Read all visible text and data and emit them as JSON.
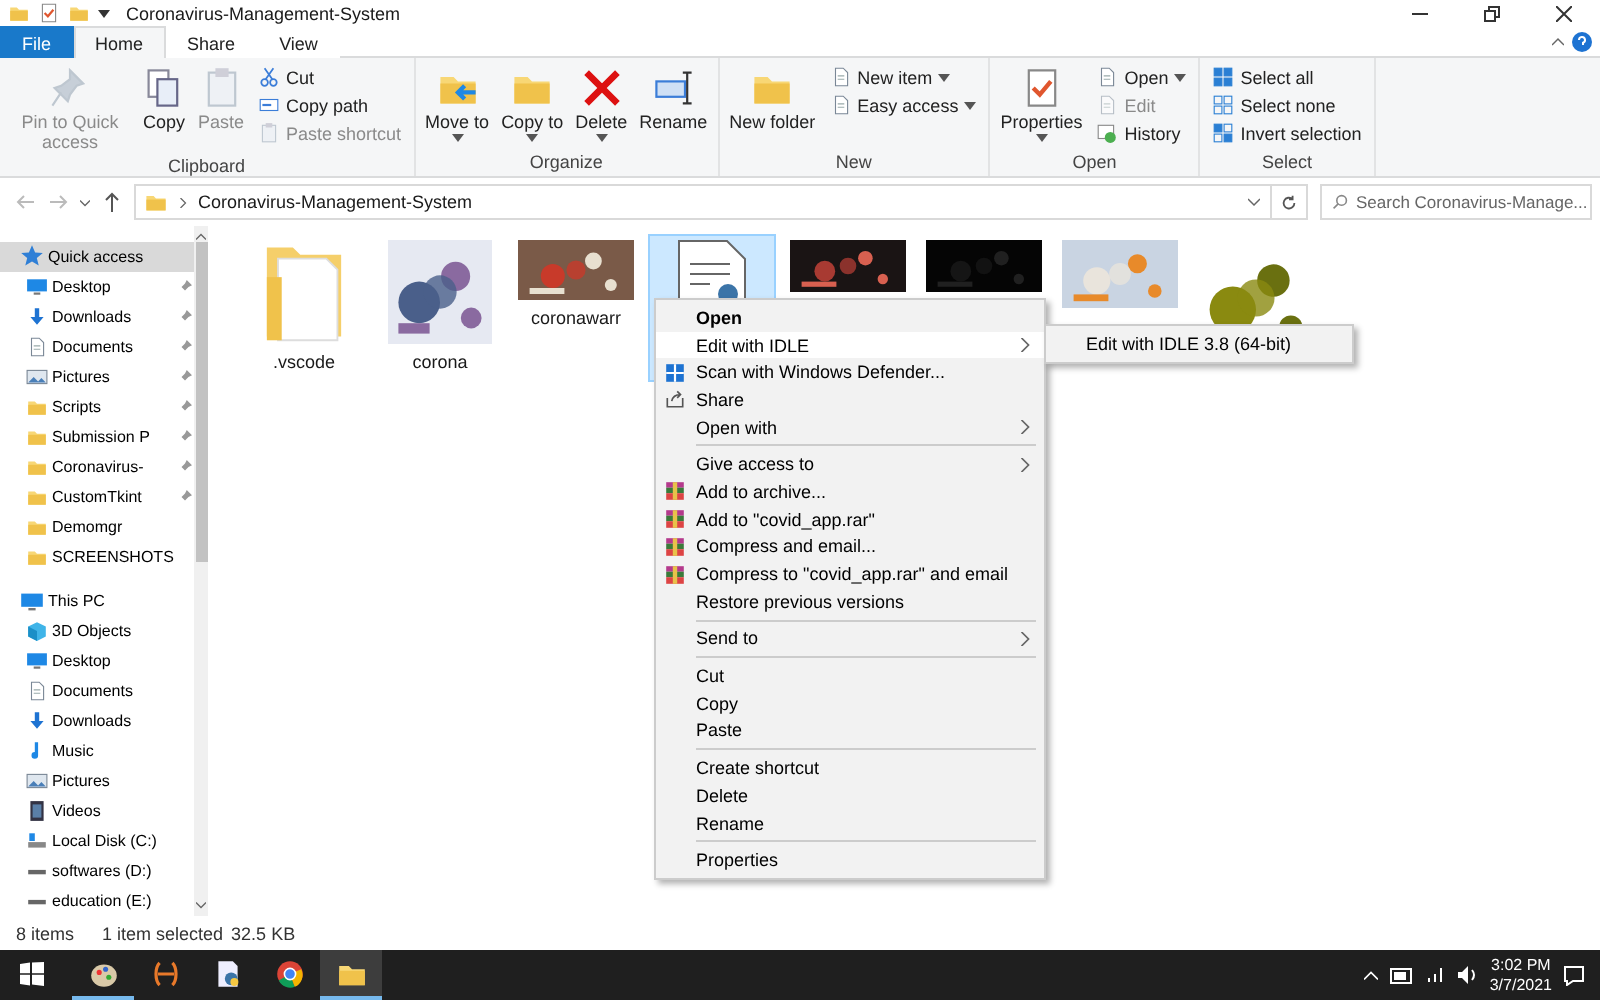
{
  "window": {
    "title": "Coronavirus-Management-System"
  },
  "tabs": [
    {
      "label": "File",
      "kind": "file",
      "selected": false
    },
    {
      "label": "Home",
      "kind": "tab",
      "selected": true
    },
    {
      "label": "Share",
      "kind": "tab",
      "selected": false
    },
    {
      "label": "View",
      "kind": "tab",
      "selected": false
    }
  ],
  "ribbon": [
    {
      "label": "Clipboard",
      "large": [
        {
          "label": "Pin to Quick access",
          "kind": "pin",
          "disabled": true,
          "dropdown": false
        },
        {
          "label": "Copy",
          "kind": "copy",
          "disabled": false,
          "dropdown": false
        },
        {
          "label": "Paste",
          "kind": "paste",
          "disabled": true,
          "dropdown": false
        }
      ],
      "small": [
        {
          "label": "Cut",
          "kind": "cut",
          "disabled": false,
          "dropdown": false
        },
        {
          "label": "Copy path",
          "kind": "copypath",
          "disabled": false,
          "dropdown": false
        },
        {
          "label": "Paste shortcut",
          "kind": "pasteshortcut",
          "disabled": true,
          "dropdown": false
        }
      ]
    },
    {
      "label": "Organize",
      "large": [
        {
          "label": "Move to",
          "kind": "move",
          "disabled": false,
          "dropdown": true
        },
        {
          "label": "Copy to",
          "kind": "copyto",
          "disabled": false,
          "dropdown": true
        },
        {
          "label": "Delete",
          "kind": "delete",
          "disabled": false,
          "dropdown": true
        },
        {
          "label": "Rename",
          "kind": "rename",
          "disabled": false,
          "dropdown": false
        }
      ]
    },
    {
      "label": "New",
      "large": [
        {
          "label": "New folder",
          "kind": "folder",
          "disabled": false,
          "dropdown": false
        }
      ],
      "small": [
        {
          "label": "New item",
          "kind": "newitem",
          "disabled": false,
          "dropdown": true
        },
        {
          "label": "Easy access",
          "kind": "easy",
          "disabled": false,
          "dropdown": true
        }
      ]
    },
    {
      "label": "Open",
      "large": [
        {
          "label": "Properties",
          "kind": "properties",
          "disabled": false,
          "dropdown": true
        }
      ],
      "small": [
        {
          "label": "Open",
          "kind": "open",
          "disabled": false,
          "dropdown": true
        },
        {
          "label": "Edit",
          "kind": "edit",
          "disabled": true,
          "dropdown": false
        },
        {
          "label": "History",
          "kind": "history",
          "disabled": false,
          "dropdown": false
        }
      ]
    },
    {
      "label": "Select",
      "small": [
        {
          "label": "Select all",
          "kind": "selectall",
          "disabled": false,
          "dropdown": false
        },
        {
          "label": "Select none",
          "kind": "selectnone",
          "disabled": false,
          "dropdown": false
        },
        {
          "label": "Invert selection",
          "kind": "invert",
          "disabled": false,
          "dropdown": false
        }
      ]
    }
  ],
  "address": {
    "path": "Coronavirus-Management-System",
    "search_placeholder": "Search Coronavirus-Manage..."
  },
  "sidebar": [
    {
      "label": "Quick access",
      "kind": "star",
      "pinned": false,
      "selected": true,
      "children": [
        {
          "label": "Desktop",
          "kind": "desktop",
          "pinned": true,
          "selected": false
        },
        {
          "label": "Downloads",
          "kind": "download",
          "pinned": true,
          "selected": false
        },
        {
          "label": "Documents",
          "kind": "documents",
          "pinned": true,
          "selected": false
        },
        {
          "label": "Pictures",
          "kind": "pictures",
          "pinned": true,
          "selected": false
        },
        {
          "label": "Scripts",
          "kind": "folder",
          "pinned": true,
          "selected": false
        },
        {
          "label": "Submission P",
          "kind": "folder",
          "pinned": true,
          "selected": false
        },
        {
          "label": "Coronavirus-",
          "kind": "folder",
          "pinned": true,
          "selected": false
        },
        {
          "label": "CustomTkint",
          "kind": "folder",
          "pinned": true,
          "selected": false
        },
        {
          "label": "Demomgr",
          "kind": "folder",
          "pinned": false,
          "selected": false
        },
        {
          "label": "SCREENSHOTS",
          "kind": "folder",
          "pinned": false,
          "selected": false
        }
      ]
    },
    {
      "label": "This PC",
      "kind": "pc",
      "pinned": false,
      "selected": false,
      "children": [
        {
          "label": "3D Objects",
          "kind": "cube",
          "pinned": false,
          "selected": false
        },
        {
          "label": "Desktop",
          "kind": "desktop",
          "pinned": false,
          "selected": false
        },
        {
          "label": "Documents",
          "kind": "documents",
          "pinned": false,
          "selected": false
        },
        {
          "label": "Downloads",
          "kind": "download",
          "pinned": false,
          "selected": false
        },
        {
          "label": "Music",
          "kind": "music",
          "pinned": false,
          "selected": false
        },
        {
          "label": "Pictures",
          "kind": "pictures",
          "pinned": false,
          "selected": false
        },
        {
          "label": "Videos",
          "kind": "videos",
          "pinned": false,
          "selected": false
        },
        {
          "label": "Local Disk (C:)",
          "kind": "disk",
          "pinned": false,
          "selected": false
        },
        {
          "label": "softwares (D:)",
          "kind": "drive",
          "pinned": false,
          "selected": false
        },
        {
          "label": "education (E:)",
          "kind": "drive",
          "pinned": false,
          "selected": false
        }
      ]
    }
  ],
  "files": [
    {
      "name": ".vscode",
      "kind": "folder",
      "selected": false
    },
    {
      "name": "corona",
      "kind": "picture",
      "selected": false
    },
    {
      "name": "coronawarr",
      "kind": "picture",
      "selected": false
    },
    {
      "kind": "python",
      "selected": true
    },
    {
      "kind": "picture",
      "selected": false
    },
    {
      "kind": "picture",
      "selected": false
    },
    {
      "kind": "picture",
      "selected": false
    },
    {
      "kind": "picture",
      "selected": false
    }
  ],
  "context_menu": [
    {
      "kind": "item",
      "label": "Open",
      "default": true,
      "selected": false,
      "submenu": false
    },
    {
      "kind": "item",
      "label": "Edit with IDLE",
      "default": false,
      "selected": true,
      "submenu": true
    },
    {
      "kind": "defender",
      "label": "Scan with Windows Defender...",
      "default": false,
      "selected": false,
      "submenu": false
    },
    {
      "kind": "share",
      "label": "Share",
      "default": false,
      "selected": false,
      "submenu": false
    },
    {
      "kind": "item",
      "label": "Open with",
      "default": false,
      "selected": false,
      "submenu": true
    },
    {
      "kind": "separator"
    },
    {
      "kind": "item",
      "label": "Give access to",
      "default": false,
      "selected": false,
      "submenu": true
    },
    {
      "kind": "rar",
      "label": "Add to archive...",
      "default": false,
      "selected": false,
      "submenu": false
    },
    {
      "kind": "rar",
      "label": "Add to \"covid_app.rar\"",
      "default": false,
      "selected": false,
      "submenu": false
    },
    {
      "kind": "rar",
      "label": "Compress and email...",
      "default": false,
      "selected": false,
      "submenu": false
    },
    {
      "kind": "rar",
      "label": "Compress to \"covid_app.rar\" and email",
      "default": false,
      "selected": false,
      "submenu": false
    },
    {
      "kind": "item",
      "label": "Restore previous versions",
      "default": false,
      "selected": false,
      "submenu": false
    },
    {
      "kind": "separator"
    },
    {
      "kind": "item",
      "label": "Send to",
      "default": false,
      "selected": false,
      "submenu": true
    },
    {
      "kind": "separator"
    },
    {
      "kind": "item",
      "label": "Cut",
      "default": false,
      "selected": false,
      "submenu": false
    },
    {
      "kind": "item",
      "label": "Copy",
      "default": false,
      "selected": false,
      "submenu": false
    },
    {
      "kind": "item",
      "label": "Paste",
      "default": false,
      "selected": false,
      "submenu": false
    },
    {
      "kind": "separator"
    },
    {
      "kind": "item",
      "label": "Create shortcut",
      "default": false,
      "selected": false,
      "submenu": false
    },
    {
      "kind": "item",
      "label": "Delete",
      "default": false,
      "selected": false,
      "submenu": false
    },
    {
      "kind": "item",
      "label": "Rename",
      "default": false,
      "selected": false,
      "submenu": false
    },
    {
      "kind": "separator"
    },
    {
      "kind": "item",
      "label": "Properties",
      "default": false,
      "selected": false,
      "submenu": false
    }
  ],
  "submenu": [
    "Edit with IDLE 3.8 (64-bit)"
  ],
  "status_bar": {
    "count": "8 items",
    "selection": "1 item selected",
    "size": "32.5 KB"
  },
  "taskbar": {
    "apps": [
      {
        "kind": "paint",
        "active": false,
        "running": true
      },
      {
        "kind": "bracket",
        "active": false,
        "running": false
      },
      {
        "kind": "python",
        "active": false,
        "running": false
      },
      {
        "kind": "chrome",
        "active": false,
        "running": false
      },
      {
        "kind": "explorer",
        "active": true,
        "running": true
      }
    ],
    "time": "3:02 PM",
    "date": "3/7/2021"
  }
}
